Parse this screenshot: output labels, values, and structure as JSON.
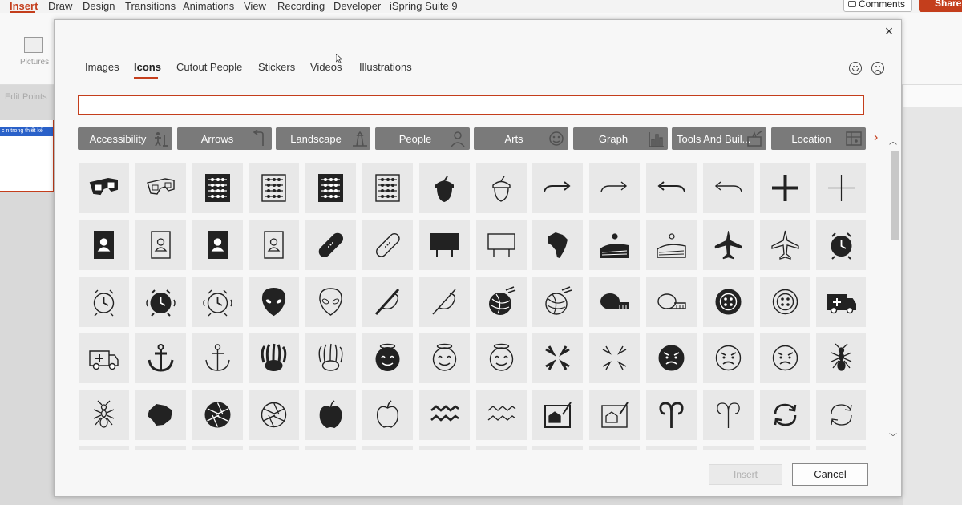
{
  "ribbon": {
    "tabs": [
      "Insert",
      "Draw",
      "Design",
      "Transitions",
      "Animations",
      "View",
      "Recording",
      "Developer",
      "iSpring Suite 9"
    ],
    "comments_label": "Comments",
    "share_label": "Share",
    "pictures_label": "Pictures",
    "edit_points_label": "Edit Points"
  },
  "slide_panel": {
    "thumb_text": "c n trong thiết kế"
  },
  "dialog": {
    "close_label": "×",
    "tabs": [
      "Images",
      "Icons",
      "Cutout People",
      "Stickers",
      "Videos",
      "Illustrations"
    ],
    "active_tab": "Icons",
    "search": {
      "value": "",
      "placeholder": ""
    },
    "categories": [
      {
        "label": "Accessibility",
        "icon": "accessibility-icon"
      },
      {
        "label": "Arrows",
        "icon": "arrow-icon"
      },
      {
        "label": "Landscape",
        "icon": "lighthouse-icon"
      },
      {
        "label": "People",
        "icon": "person-icon"
      },
      {
        "label": "Arts",
        "icon": "mask-icon"
      },
      {
        "label": "Graph",
        "icon": "bar-graph-icon"
      },
      {
        "label": "Tools And Buil...",
        "icon": "tools-icon"
      },
      {
        "label": "Location",
        "icon": "map-icon"
      }
    ],
    "icon_rows": [
      [
        "3d-glasses-filled-icon",
        "3d-glasses-outline-icon",
        "abacus-filled-icon",
        "abacus-outline-icon",
        "abacus-wide-filled-icon",
        "abacus-wide-outline-icon",
        "acorn-filled-icon",
        "acorn-outline-icon",
        "arrow-turn-right-filled-icon",
        "arrow-turn-right-outline-icon",
        "arrow-turn-left-filled-icon",
        "arrow-turn-left-outline-icon",
        "add-filled-icon",
        "add-outline-icon"
      ],
      [
        "address-book-filled-icon",
        "address-book-outline-icon",
        "address-book-2-filled-icon",
        "address-book-2-outline-icon",
        "adhesive-bandage-filled-icon",
        "adhesive-bandage-outline-icon",
        "billboard-filled-icon",
        "billboard-outline-icon",
        "africa-icon",
        "agriculture-filled-icon",
        "agriculture-outline-icon",
        "airplane-filled-icon",
        "airplane-outline-icon",
        "alarm-clock-filled-icon"
      ],
      [
        "alarm-clock-outline-icon",
        "alarm-ringing-filled-icon",
        "alarm-ringing-outline-icon",
        "alien-filled-icon",
        "alien-outline-icon",
        "needle-filled-icon",
        "needle-outline-icon",
        "yarn-filled-icon",
        "yarn-outline-icon",
        "tape-measure-filled-icon",
        "tape-measure-outline-icon",
        "button-filled-icon",
        "button-outline-icon",
        "ambulance-filled-icon"
      ],
      [
        "ambulance-outline-icon",
        "anchor-filled-icon",
        "anchor-outline-icon",
        "anemone-filled-icon",
        "anemone-outline-icon",
        "angel-face-filled-icon",
        "angel-face-outline-icon",
        "angel-face-outline-2-icon",
        "anger-filled-icon",
        "anger-outline-icon",
        "angry-face-filled-icon",
        "angry-face-outline-icon",
        "angry-face-outline-2-icon",
        "ant-filled-icon"
      ],
      [
        "ant-outline-icon",
        "antarctica-icon",
        "aperture-filled-icon",
        "aperture-outline-icon",
        "apple-filled-icon",
        "apple-outline-icon",
        "aquarius-filled-icon",
        "aquarius-outline-icon",
        "architect-filled-icon",
        "architect-outline-icon",
        "aries-filled-icon",
        "aries-outline-icon",
        "refresh-filled-icon",
        "refresh-outline-icon"
      ]
    ],
    "insert_label": "Insert",
    "cancel_label": "Cancel"
  }
}
